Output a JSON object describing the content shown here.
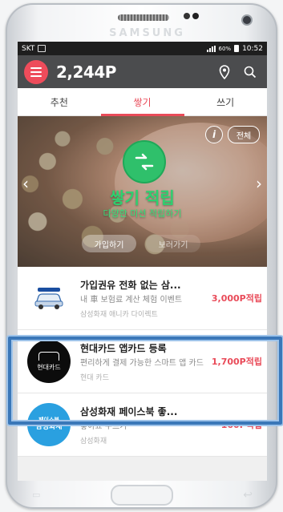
{
  "device": {
    "brand": "SAMSUNG"
  },
  "status_bar": {
    "carrier": "SKT",
    "time": "10:52",
    "battery": "60%"
  },
  "app_bar": {
    "points": "2,244P",
    "icons": [
      "menu-icon",
      "location-pin-icon",
      "search-icon"
    ]
  },
  "tabs": [
    {
      "label": "추천",
      "active": false
    },
    {
      "label": "쌓기",
      "active": true
    },
    {
      "label": "쓰기",
      "active": false
    }
  ],
  "banner": {
    "title": "쌓기 적립",
    "subtitle": "다양한 미션 적립하기",
    "button_1": "가입하기",
    "button_2": "보러가기",
    "info_label": "i",
    "all_label": "전체"
  },
  "offers": [
    {
      "title": "가입권유 전화 없는 삼...",
      "desc": "내 車 보험료 계산 체험 이벤트",
      "sponsor": "삼성화재 애니카 다이렉트",
      "reward": "3,000P적립",
      "icon": "car-icon"
    },
    {
      "title": "현대카드 앱카드 등록",
      "desc": "편리하게 결제 가능한 스마트 앱 카드",
      "sponsor": "현대 카드",
      "reward": "1,700P적립",
      "icon": "hyundai-card-icon",
      "thumb_text": "현대카드"
    },
    {
      "title": "삼성화재 페이스북 좋...",
      "desc": "좋아요 누르기",
      "sponsor": "삼성화재",
      "reward": "160P적립",
      "icon": "samsung-fire-icon",
      "thumb_text_1": "페이스북",
      "thumb_text_2": "삼성화재"
    }
  ],
  "colors": {
    "accent": "#e94b59",
    "appbar": "#4b4c4e",
    "highlight": "#3a77b8"
  }
}
